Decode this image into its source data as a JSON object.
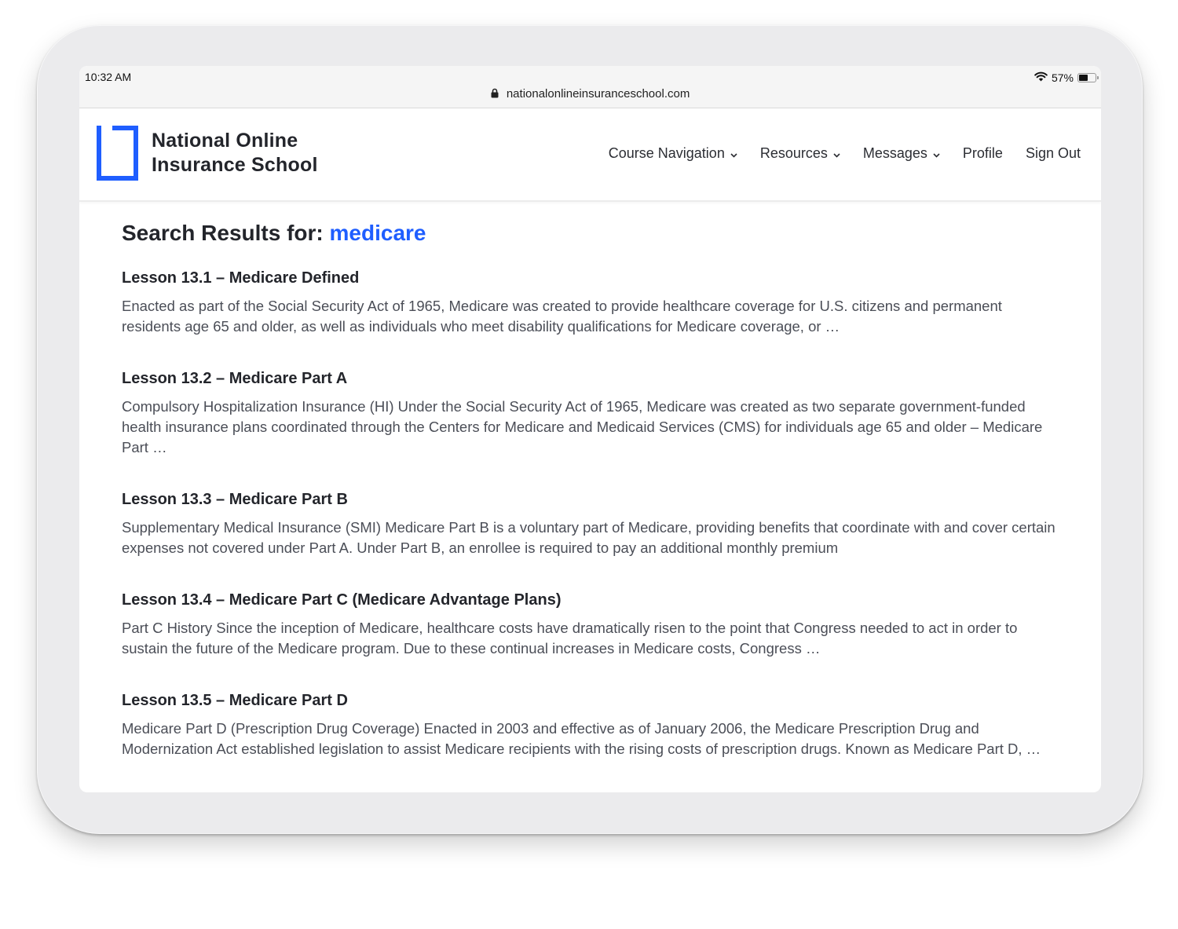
{
  "status_bar": {
    "time": "10:32 AM",
    "battery_percent_label": "57%",
    "battery_level": 0.57,
    "wifi_icon": "wifi-icon",
    "battery_icon": "battery-icon"
  },
  "browser": {
    "url": "nationalonlineinsuranceschool.com",
    "lock_icon": "lock-icon"
  },
  "header": {
    "logo_line1": "National Online",
    "logo_line2": "Insurance School",
    "brand_color": "#1f5eff",
    "nav": [
      {
        "label": "Course Navigation",
        "has_dropdown": true
      },
      {
        "label": "Resources",
        "has_dropdown": true
      },
      {
        "label": "Messages",
        "has_dropdown": true
      },
      {
        "label": "Profile",
        "has_dropdown": false
      },
      {
        "label": "Sign Out",
        "has_dropdown": false
      }
    ]
  },
  "search": {
    "title_prefix": "Search Results for: ",
    "query": "medicare",
    "results": [
      {
        "title": "Lesson 13.1 – Medicare Defined",
        "excerpt": "Enacted as part of the Social Security Act of 1965, Medicare was created to provide healthcare coverage for U.S. citizens and permanent residents age 65 and older, as well as individuals who meet disability qualifications for Medicare coverage, or …"
      },
      {
        "title": "Lesson 13.2 – Medicare Part A",
        "excerpt": "Compulsory Hospitalization Insurance (HI) Under the Social Security Act of 1965, Medicare was created as two separate government-funded health insurance plans coordinated through the Centers for Medicare and Medicaid Services (CMS) for individuals age 65 and older – Medicare Part …"
      },
      {
        "title": "Lesson 13.3 – Medicare Part B",
        "excerpt": "Supplementary Medical Insurance (SMI) Medicare Part B is a voluntary part of Medicare, providing benefits that coordinate with and cover certain expenses not covered under Part A.  Under Part B, an enrollee is required to pay an additional monthly premium"
      },
      {
        "title": "Lesson 13.4 – Medicare Part C (Medicare Advantage Plans)",
        "excerpt": "Part C History Since the inception of Medicare, healthcare costs have dramatically risen to the point that Congress needed to act in order to sustain the future of the Medicare program.  Due to these continual increases in Medicare costs, Congress …"
      },
      {
        "title": "Lesson 13.5 – Medicare Part D",
        "excerpt": "Medicare Part D (Prescription Drug Coverage) Enacted in 2003 and effective as of January 2006, the Medicare Prescription Drug and Modernization Act established legislation to assist Medicare recipients with the rising costs of prescription drugs. Known as Medicare Part D, …"
      }
    ]
  }
}
